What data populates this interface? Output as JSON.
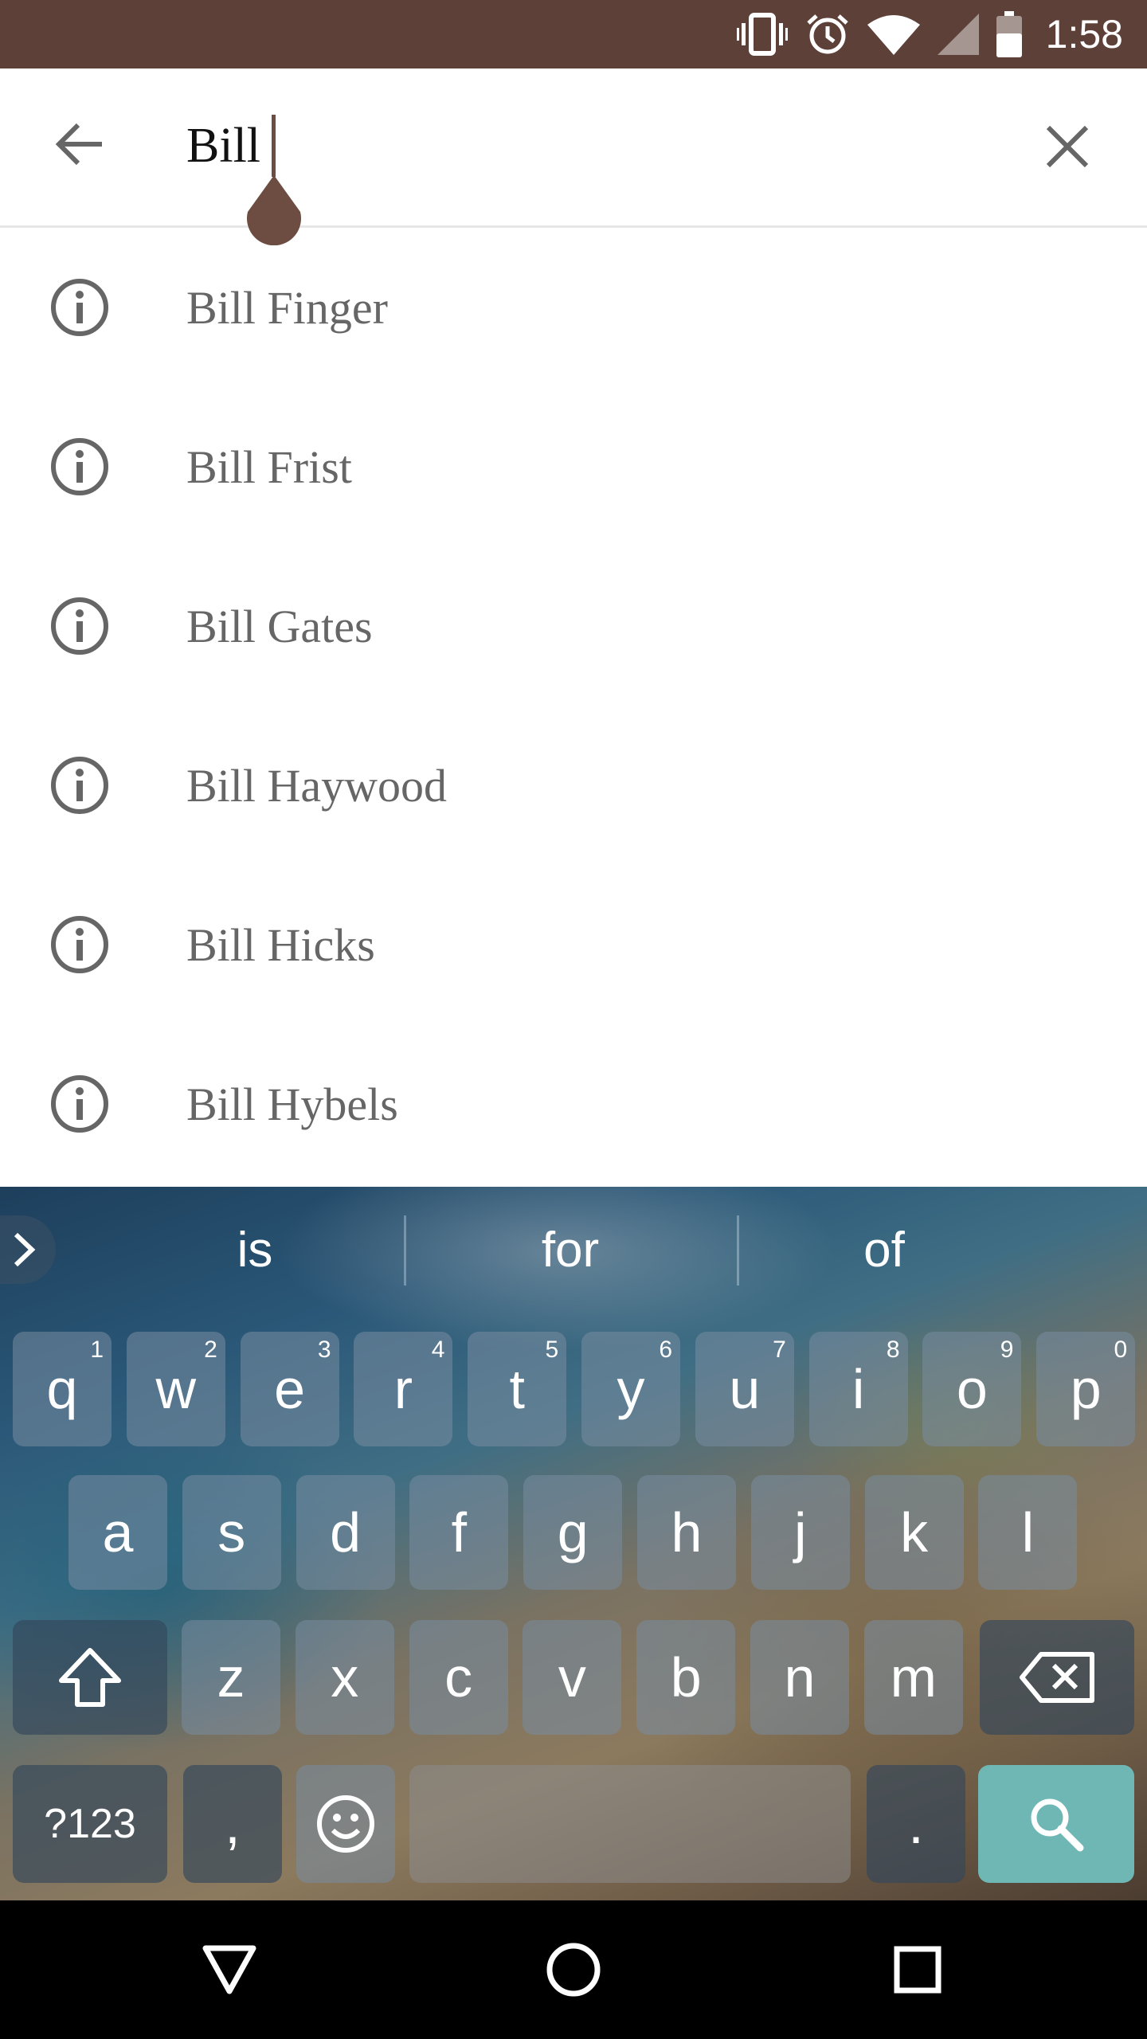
{
  "status_bar": {
    "time": "1:58",
    "icons": [
      "vibrate-icon",
      "alarm-icon",
      "wifi-icon",
      "signal-icon",
      "battery-icon"
    ],
    "background": "#5d4037"
  },
  "search": {
    "query": "Bill",
    "back_icon": "arrow-back-icon",
    "clear_icon": "close-icon",
    "accent": "#6d4c41"
  },
  "suggestions": [
    {
      "label": "Bill Finger",
      "icon": "info-icon"
    },
    {
      "label": "Bill Frist",
      "icon": "info-icon"
    },
    {
      "label": "Bill Gates",
      "icon": "info-icon"
    },
    {
      "label": "Bill Haywood",
      "icon": "info-icon"
    },
    {
      "label": "Bill Hicks",
      "icon": "info-icon"
    },
    {
      "label": "Bill Hybels",
      "icon": "info-icon"
    }
  ],
  "keyboard": {
    "word_suggestions": [
      "is",
      "for",
      "of"
    ],
    "row1": [
      {
        "key": "q",
        "hint": "1"
      },
      {
        "key": "w",
        "hint": "2"
      },
      {
        "key": "e",
        "hint": "3"
      },
      {
        "key": "r",
        "hint": "4"
      },
      {
        "key": "t",
        "hint": "5"
      },
      {
        "key": "y",
        "hint": "6"
      },
      {
        "key": "u",
        "hint": "7"
      },
      {
        "key": "i",
        "hint": "8"
      },
      {
        "key": "o",
        "hint": "9"
      },
      {
        "key": "p",
        "hint": "0"
      }
    ],
    "row2": [
      "a",
      "s",
      "d",
      "f",
      "g",
      "h",
      "j",
      "k",
      "l"
    ],
    "row3": [
      "z",
      "x",
      "c",
      "v",
      "b",
      "n",
      "m"
    ],
    "symbols_label": "?123",
    "comma_label": ",",
    "period_label": ".",
    "search_color": "#6fb7b4"
  },
  "nav_bar": {
    "buttons": [
      "back-triangle-icon",
      "home-circle-icon",
      "recents-square-icon"
    ]
  }
}
